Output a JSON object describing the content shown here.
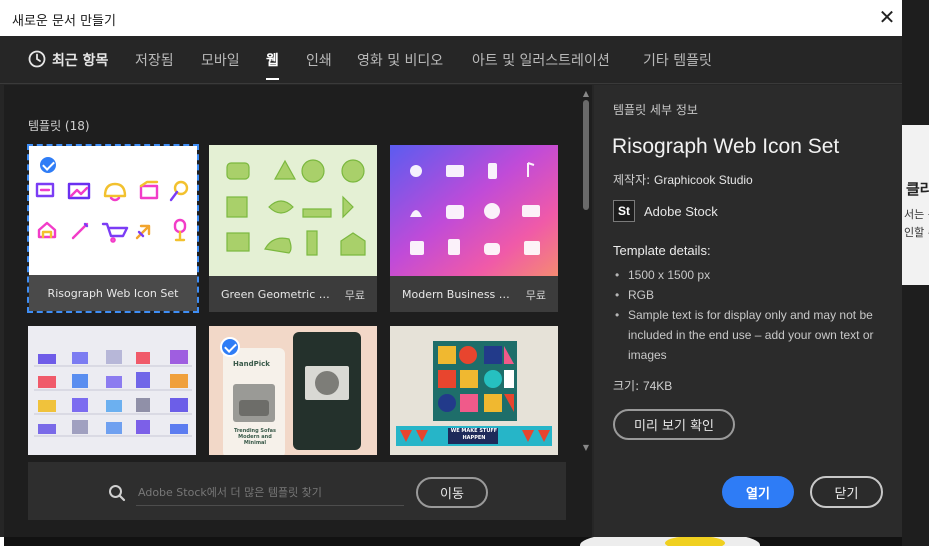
{
  "window": {
    "title": "새로운 문서 만들기",
    "close_glyph": "✕"
  },
  "tabs": [
    {
      "label": "최근 항목",
      "icon": "clock-icon"
    },
    {
      "label": "저장됨"
    },
    {
      "label": "모바일"
    },
    {
      "label": "웹",
      "active": true
    },
    {
      "label": "인쇄"
    },
    {
      "label": "영화 및 비디오"
    },
    {
      "label": "아트 및 일러스트레이션"
    },
    {
      "label": "기타 템플릿"
    }
  ],
  "templates": {
    "section_label": "템플릿 (18)",
    "items": [
      {
        "name": "Risograph Web Icon Set",
        "free": "",
        "selected": true
      },
      {
        "name": "Green Geometric Or...",
        "free": "무료"
      },
      {
        "name": "Modern Business We...",
        "free": "무료"
      },
      {
        "name": "",
        "free": ""
      },
      {
        "name": "",
        "free": "",
        "checked": true
      },
      {
        "name": "",
        "free": ""
      }
    ],
    "thumb_text": {
      "handpick": "HandPick",
      "trending": "Trending Sofas Modern and Minimal",
      "make_stuff": "WE MAKE STUFF HAPPEN"
    }
  },
  "search": {
    "placeholder": "Adobe Stock에서 더 많은 템플릿 찾기",
    "go_label": "이동"
  },
  "details": {
    "label": "템플릿 세부 정보",
    "title": "Risograph Web Icon Set",
    "author_label": "제작자:",
    "author": "Graphicook Studio",
    "stock_logo": "St",
    "stock_name": "Adobe Stock",
    "details_title": "Template details:",
    "items": [
      "1500 x 1500 px",
      "RGB",
      "Sample text is for display only and may not be included in the end use – add your own text or images"
    ],
    "size_label": "크기:",
    "size_value": "74KB",
    "preview_label": "미리 보기 확인",
    "open_label": "열기",
    "close_label": "닫기"
  },
  "background": {
    "right_text_1": "클라",
    "right_text_2": "서는 동",
    "right_text_3": "인할 수"
  },
  "colors": {
    "accent": "#2e7cf6",
    "dialog_bg": "#262626",
    "panel_bg": "#1e1e1e"
  }
}
